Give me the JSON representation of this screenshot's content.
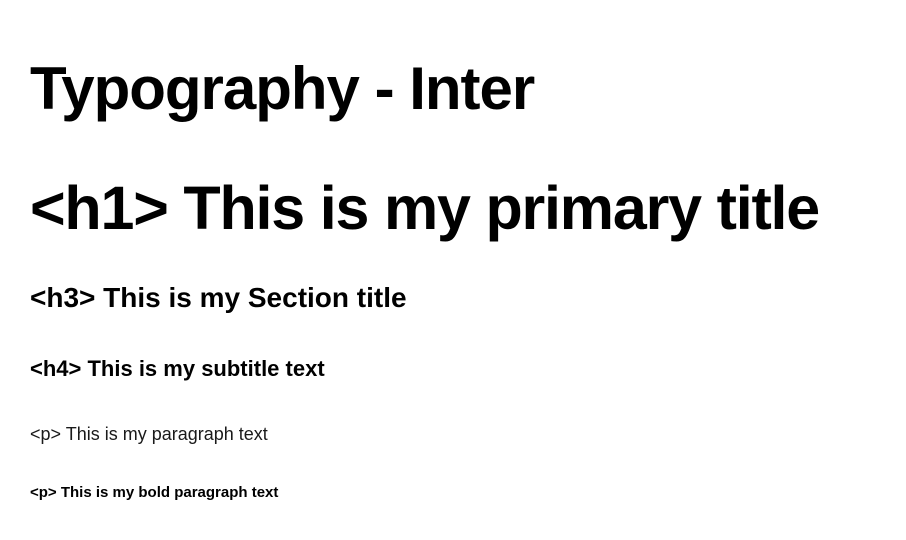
{
  "page_title": "Typography - Inter",
  "samples": {
    "h1": "<h1> This is my primary title",
    "h3": "<h3> This is my Section title",
    "h4": "<h4> This is my subtitle text",
    "p": "<p> This is my paragraph text",
    "p_bold": "<p> This is my bold paragraph text"
  }
}
